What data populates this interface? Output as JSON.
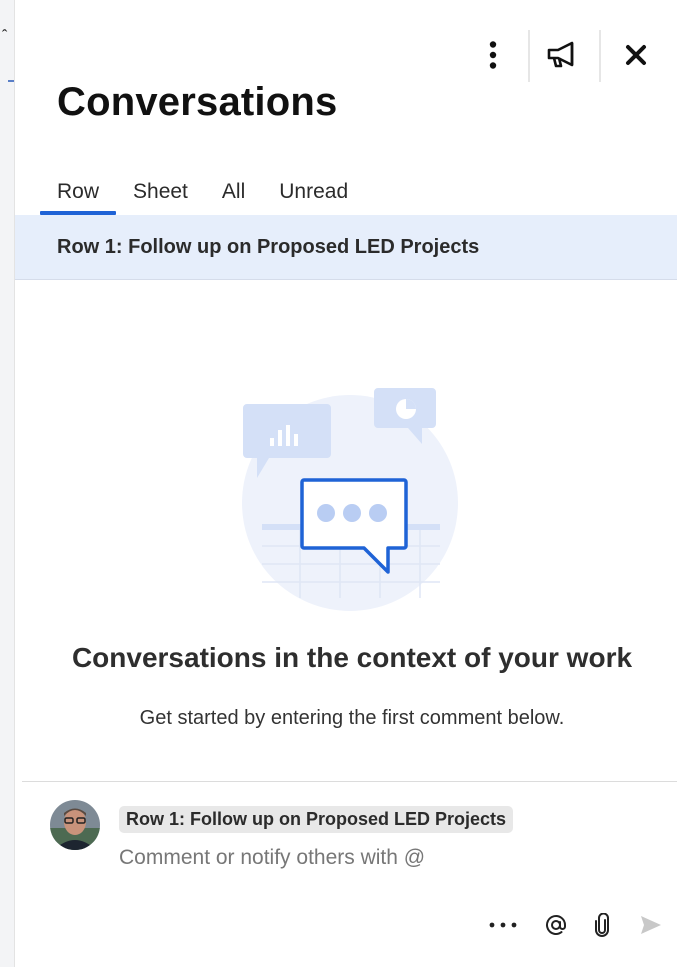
{
  "panel": {
    "title": "Conversations",
    "icons": {
      "more": "vertical-ellipsis-icon",
      "announce": "megaphone-icon",
      "close": "close-icon"
    }
  },
  "tabs": [
    {
      "label": "Row",
      "active": true
    },
    {
      "label": "Sheet",
      "active": false
    },
    {
      "label": "All",
      "active": false
    },
    {
      "label": "Unread",
      "active": false
    }
  ],
  "row_banner": "Row 1: Follow up on Proposed LED Projects",
  "empty_state": {
    "title": "Conversations in the context of your work",
    "subtitle": "Get started by entering the first comment below."
  },
  "composer": {
    "row_chip": "Row 1: Follow up on Proposed LED Projects",
    "placeholder": "Comment or notify others with @",
    "tools": {
      "more": "horizontal-ellipsis-icon",
      "mention": "at-icon",
      "attach": "paperclip-icon",
      "send": "send-icon"
    }
  },
  "colors": {
    "accent": "#1f63d6",
    "banner": "#e6eefb",
    "illustration_light": "#eef2fb",
    "illustration_mid": "#d4e0f7"
  }
}
